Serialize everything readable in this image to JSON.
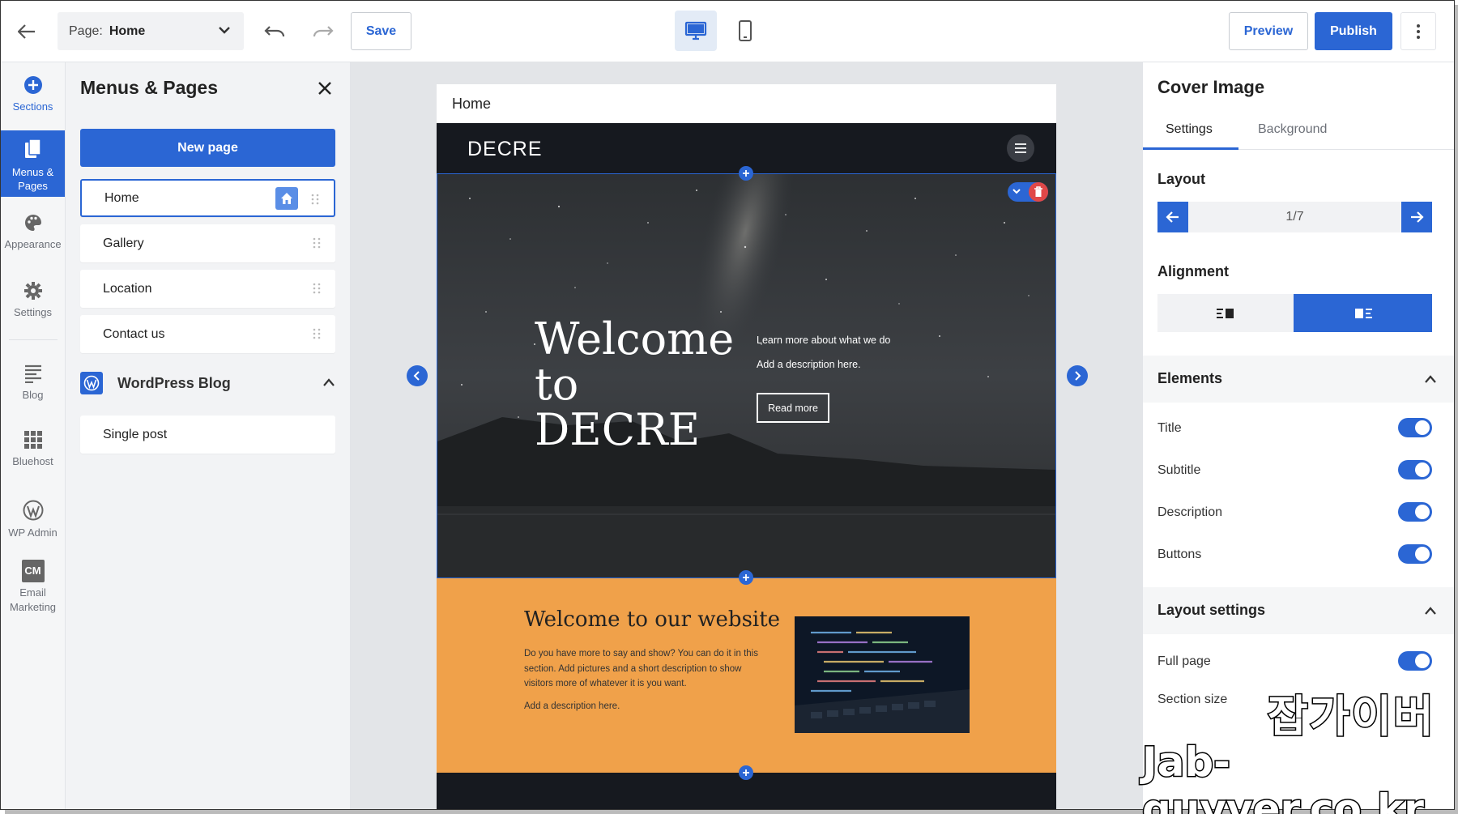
{
  "topbar": {
    "page_label": "Page:",
    "page_value": "Home",
    "save": "Save",
    "preview": "Preview",
    "publish": "Publish"
  },
  "rail": {
    "items": [
      {
        "label": "Sections",
        "icon": "plus-circle-icon"
      },
      {
        "label": "Menus & Pages",
        "icon": "pages-icon"
      },
      {
        "label": "Appearance",
        "icon": "palette-icon"
      },
      {
        "label": "Settings",
        "icon": "gear-icon"
      },
      {
        "label": "Blog",
        "icon": "blog-icon"
      },
      {
        "label": "Bluehost",
        "icon": "grid-icon"
      },
      {
        "label": "WP Admin",
        "icon": "wordpress-icon"
      },
      {
        "label": "Email Marketing",
        "icon": "cm-icon",
        "badge": "CM"
      }
    ]
  },
  "panel": {
    "title": "Menus & Pages",
    "new_page": "New page",
    "pages": [
      "Home",
      "Gallery",
      "Location",
      "Contact us"
    ],
    "blog_title": "WordPress Blog",
    "blog_pages": [
      "Single post"
    ]
  },
  "canvas": {
    "tab_title": "Home",
    "site_logo": "DECRE",
    "hero_title": "Welcome to DECRE",
    "hero_lead": "Learn more about what we do",
    "hero_desc": "Add a description here.",
    "hero_button": "Read more",
    "section2_title": "Welcome to our website",
    "section2_body": "Do you have more to say and show? You can do it in this section. Add pictures and a short description to show visitors more of whatever it is you want.",
    "section2_desc": "Add a description here."
  },
  "right_panel": {
    "title": "Cover Image",
    "tabs": [
      "Settings",
      "Background"
    ],
    "layout_label": "Layout",
    "layout_value": "1/7",
    "alignment_label": "Alignment",
    "elements_label": "Elements",
    "elements": [
      {
        "label": "Title",
        "on": true
      },
      {
        "label": "Subtitle",
        "on": true
      },
      {
        "label": "Description",
        "on": true
      },
      {
        "label": "Buttons",
        "on": true
      }
    ],
    "layout_settings_label": "Layout settings",
    "full_page_label": "Full page",
    "full_page_on": true,
    "section_size_label": "Section size"
  },
  "watermark": {
    "korean": "잡가이버",
    "url": "Jab-guyver.co.kr"
  },
  "colors": {
    "accent": "#2b66d4",
    "dark": "#16191f",
    "orange": "#f0a14a",
    "danger": "#e04848"
  }
}
